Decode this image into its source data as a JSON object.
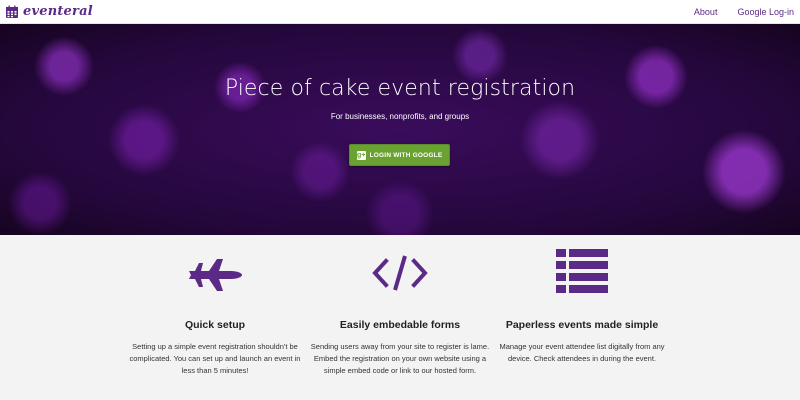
{
  "brand": {
    "name": "eventeral",
    "icon": "calendar-icon",
    "color": "#5b2a86"
  },
  "nav": {
    "about": "About",
    "google_login": "Google Log-in"
  },
  "hero": {
    "title": "Piece of cake event registration",
    "subtitle": "For businesses, nonprofits, and groups",
    "button_label": "LOGIN WITH GOOGLE",
    "button_icon": "google-plus-icon",
    "button_color": "#6aa232"
  },
  "features": [
    {
      "icon": "fighter-jet-icon",
      "title": "Quick setup",
      "text": "Setting up a simple event registration shouldn't be complicated. You can set up and launch an event in less than 5 minutes!"
    },
    {
      "icon": "code-icon",
      "title": "Easily embedable forms",
      "text": "Sending users away from your site to register is lame. Embed the registration on your own website using a simple embed code or link to our hosted form."
    },
    {
      "icon": "list-icon",
      "title": "Paperless events made simple",
      "text": "Manage your event attendee list digitally from any device. Check attendees in during the event."
    }
  ],
  "accent_color": "#5b2a86"
}
